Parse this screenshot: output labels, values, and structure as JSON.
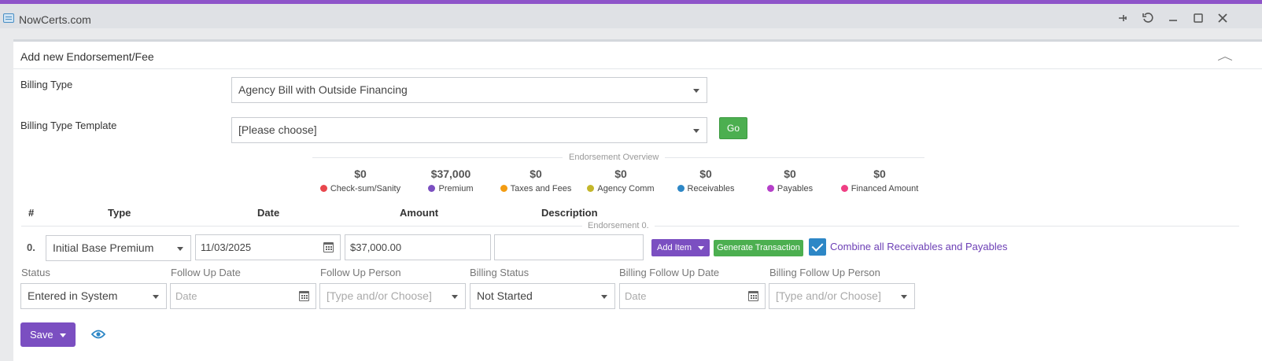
{
  "app": {
    "title": "NowCerts.com"
  },
  "panel": {
    "title": "Add new Endorsement/Fee"
  },
  "billing_type": {
    "label": "Billing Type",
    "value": "Agency Bill with Outside Financing"
  },
  "billing_template": {
    "label": "Billing Type Template",
    "value": "[Please choose]",
    "go_label": "Go"
  },
  "overview": {
    "title": "Endorsement Overview",
    "stats": [
      {
        "value": "$0",
        "label": "Check-sum/Sanity",
        "color": "#e8474d"
      },
      {
        "value": "$37,000",
        "label": "Premium",
        "color": "#7b4fc1"
      },
      {
        "value": "$0",
        "label": "Taxes and Fees",
        "color": "#f39c12"
      },
      {
        "value": "$0",
        "label": "Agency Comm",
        "color": "#c4b72a"
      },
      {
        "value": "$0",
        "label": "Receivables",
        "color": "#2d87c6"
      },
      {
        "value": "$0",
        "label": "Payables",
        "color": "#b53fc9"
      },
      {
        "value": "$0",
        "label": "Financed Amount",
        "color": "#ef3f84"
      }
    ]
  },
  "columns": {
    "num": "#",
    "type": "Type",
    "date": "Date",
    "amount": "Amount",
    "description": "Description"
  },
  "endorsement": {
    "title": "Endorsement 0.",
    "row_num": "0.",
    "type": "Initial Base Premium",
    "date": "11/03/2025",
    "amount": "$37,000.00",
    "description": "",
    "add_item_label": "Add Item",
    "generate_label": "Generate Transaction",
    "combine_label": "Combine all Receivables and Payables",
    "combine_checked": true
  },
  "status_row": {
    "status_label": "Status",
    "status_value": "Entered in System",
    "follow_up_date_label": "Follow Up Date",
    "follow_up_date_placeholder": "Date",
    "follow_up_person_label": "Follow Up Person",
    "follow_up_person_placeholder": "[Type and/or Choose]",
    "billing_status_label": "Billing Status",
    "billing_status_value": "Not Started",
    "billing_follow_up_date_label": "Billing Follow Up Date",
    "billing_follow_up_date_placeholder": "Date",
    "billing_follow_up_person_label": "Billing Follow Up Person",
    "billing_follow_up_person_placeholder": "[Type and/or Choose]"
  },
  "actions": {
    "save_label": "Save"
  }
}
